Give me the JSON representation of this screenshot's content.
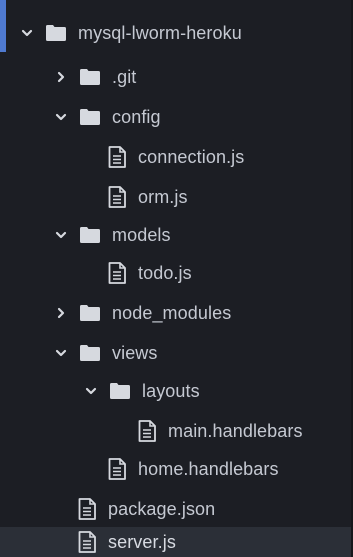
{
  "root": {
    "name": "mysql-lworm-heroku",
    "state": "expanded",
    "icon": "folder-icon"
  },
  "items": [
    {
      "name": ".git",
      "type": "folder",
      "state": "collapsed"
    },
    {
      "name": "config",
      "type": "folder",
      "state": "expanded"
    },
    {
      "name": "connection.js",
      "type": "file"
    },
    {
      "name": "orm.js",
      "type": "file"
    },
    {
      "name": "models",
      "type": "folder",
      "state": "expanded"
    },
    {
      "name": "todo.js",
      "type": "file"
    },
    {
      "name": "node_modules",
      "type": "folder",
      "state": "collapsed"
    },
    {
      "name": "views",
      "type": "folder",
      "state": "expanded"
    },
    {
      "name": "layouts",
      "type": "folder",
      "state": "expanded"
    },
    {
      "name": "main.handlebars",
      "type": "file"
    },
    {
      "name": "home.handlebars",
      "type": "file"
    },
    {
      "name": "package.json",
      "type": "file"
    },
    {
      "name": "server.js",
      "type": "file",
      "selected": true
    }
  ],
  "colors": {
    "background": "#1c1e24",
    "text": "#c5c9d2",
    "icon": "#d6d9df",
    "selected_row": "#2b2f37",
    "root_accent": "#4f7ad0"
  }
}
